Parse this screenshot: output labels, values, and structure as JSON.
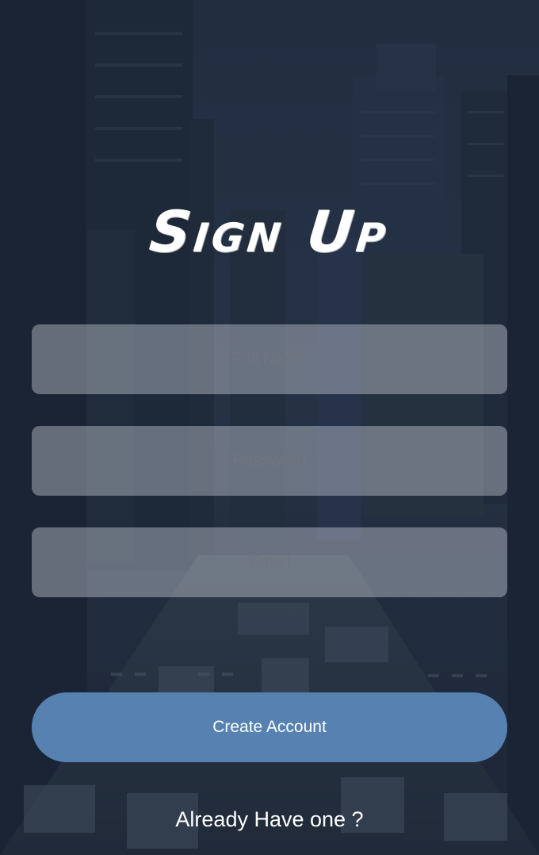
{
  "page": {
    "title": "Sign Up"
  },
  "form": {
    "full_name": {
      "placeholder": "Full Name",
      "value": ""
    },
    "password": {
      "placeholder": "Password",
      "value": ""
    },
    "email": {
      "placeholder": "Email",
      "value": ""
    },
    "submit_label": "Create Account"
  },
  "footer": {
    "signin_label": "Already Have one ?"
  },
  "colors": {
    "overlay": "#1b2638",
    "field_background": "#cdd2dc",
    "button": "#5781b0",
    "text": "#ffffff"
  }
}
